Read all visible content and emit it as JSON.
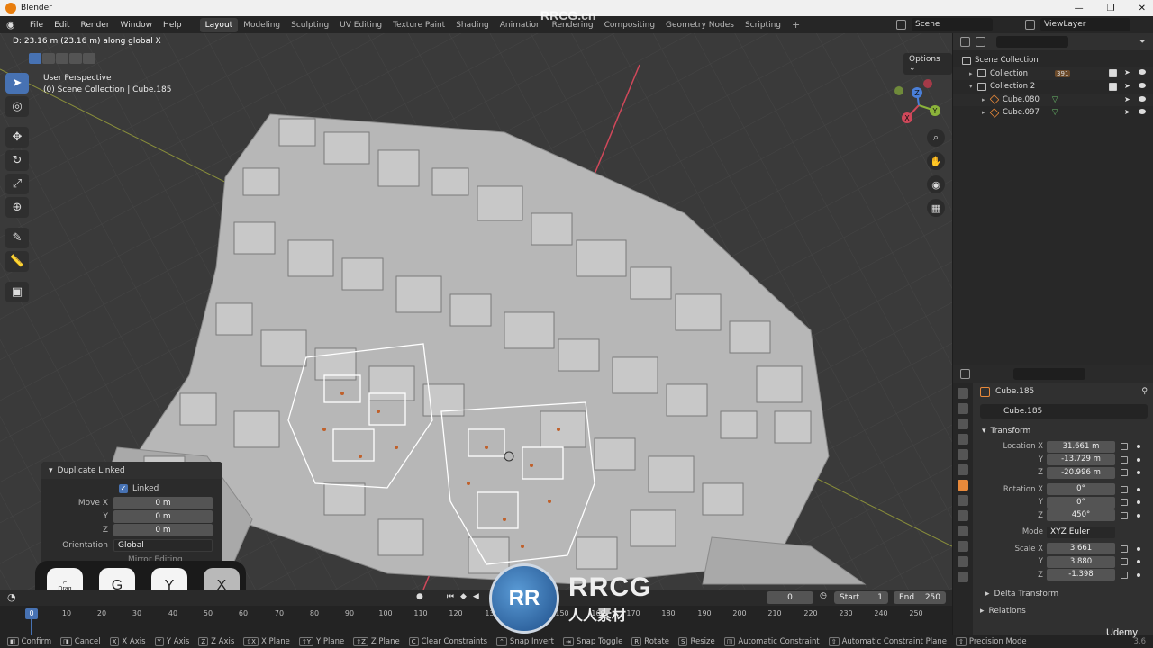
{
  "window": {
    "title": "Blender",
    "controls": [
      "—",
      "❐",
      "✕"
    ]
  },
  "menubar": {
    "menus": [
      "File",
      "Edit",
      "Render",
      "Window",
      "Help"
    ],
    "workspaces": [
      "Layout",
      "Modeling",
      "Sculpting",
      "UV Editing",
      "Texture Paint",
      "Shading",
      "Animation",
      "Rendering",
      "Compositing",
      "Geometry Nodes",
      "Scripting"
    ],
    "active_workspace": "Layout",
    "scene": "Scene",
    "view_layer": "ViewLayer"
  },
  "viewport": {
    "header_text": "D: 23.16 m (23.16 m) along global X",
    "options_label": "Options",
    "perspective": "User Perspective",
    "collection_info": "(0) Scene Collection | Cube.185",
    "gizmo_axes": [
      "X",
      "Y",
      "Z"
    ]
  },
  "redo_panel": {
    "title": "Duplicate Linked",
    "linked_label": "Linked",
    "linked_checked": true,
    "move_label": "Move X",
    "move_y_label": "Y",
    "move_z_label": "Z",
    "move_x": "0 m",
    "move_y": "0 m",
    "move_z": "0 m",
    "orientation_label": "Orientation",
    "orientation": "Global",
    "mirror_label": "Mirror Editing"
  },
  "key_overlay": {
    "mouse_label": "Drag",
    "keys": [
      "G",
      "Y",
      "X"
    ]
  },
  "outliner": {
    "items": [
      {
        "name": "Scene Collection",
        "indent": 0
      },
      {
        "name": "Collection",
        "indent": 1,
        "badge": "391"
      },
      {
        "name": "Collection 2",
        "indent": 1
      },
      {
        "name": "Cube.080",
        "indent": 2
      },
      {
        "name": "Cube.097",
        "indent": 2
      }
    ]
  },
  "properties": {
    "object_name": "Cube.185",
    "object_field": "Cube.185",
    "transform_label": "Transform",
    "location_label": "Location X",
    "rotation_label": "Rotation X",
    "scale_label": "Scale X",
    "y_label": "Y",
    "z_label": "Z",
    "location": [
      "31.661 m",
      "-13.729 m",
      "-20.996 m"
    ],
    "rotation": [
      "0°",
      "0°",
      "450°"
    ],
    "mode_label": "Mode",
    "mode": "XYZ Euler",
    "scale": [
      "3.661",
      "3.880",
      "-1.398"
    ],
    "delta_transform_label": "Delta Transform",
    "relations_label": "Relations"
  },
  "timeline": {
    "current_frame": "0",
    "start_label": "Start",
    "start": "1",
    "end_label": "End",
    "end": "250",
    "ticks": [
      "10",
      "20",
      "30",
      "40",
      "50",
      "60",
      "70",
      "80",
      "90",
      "100",
      "110",
      "120",
      "130",
      "140",
      "150",
      "160",
      "170",
      "180",
      "190",
      "200",
      "210",
      "220",
      "230",
      "240",
      "250"
    ],
    "playhead": "0"
  },
  "statusbar": {
    "items": [
      {
        "key": "",
        "label": "Confirm"
      },
      {
        "key": "",
        "label": "Cancel"
      },
      {
        "key": "X",
        "label": "X Axis"
      },
      {
        "key": "Y",
        "label": "Y Axis"
      },
      {
        "key": "Z",
        "label": "Z Axis"
      },
      {
        "key": "⇧X",
        "label": "X Plane"
      },
      {
        "key": "⇧Y",
        "label": "Y Plane"
      },
      {
        "key": "⇧Z",
        "label": "Z Plane"
      },
      {
        "key": "C",
        "label": "Clear Constraints"
      },
      {
        "key": "",
        "label": "Snap Invert"
      },
      {
        "key": "",
        "label": "Snap Toggle"
      },
      {
        "key": "R",
        "label": "Rotate"
      },
      {
        "key": "S",
        "label": "Resize"
      },
      {
        "key": "",
        "label": "Automatic Constraint"
      },
      {
        "key": "",
        "label": "Automatic Constraint Plane"
      },
      {
        "key": "",
        "label": "Precision Mode"
      }
    ],
    "version": "3.6"
  },
  "watermark": {
    "top": "RRCG.cn",
    "brand": "RRCG",
    "brand_sub": "人人素材",
    "disc": "RR",
    "udemy": "Udemy"
  }
}
